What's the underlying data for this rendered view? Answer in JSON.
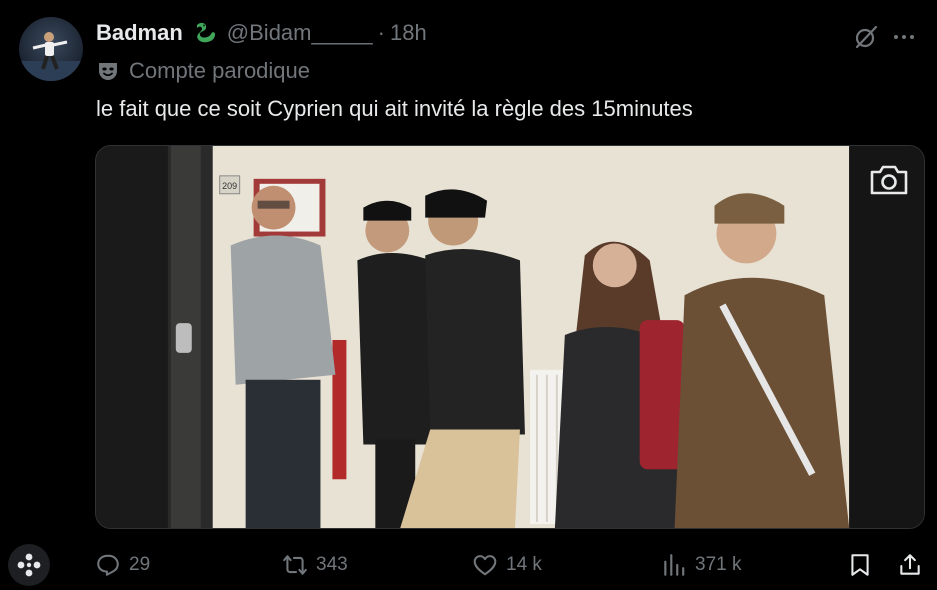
{
  "tweet": {
    "display_name": "Badman",
    "name_emoji": "dragon-emoji",
    "handle": "@Bidam_____",
    "separator": "·",
    "time": "18h",
    "parody_label": "Compte parodique",
    "text": "le fait que ce soit Cyprien qui ait invité la règle des 15minutes",
    "media": {
      "room_number": "209"
    }
  },
  "actions": {
    "replies": "29",
    "reposts": "343",
    "likes": "14 k",
    "views": "371 k"
  },
  "colors": {
    "background": "#000000",
    "text": "#e7e9ea",
    "muted": "#71767b",
    "dragon": "#3fa65a"
  }
}
